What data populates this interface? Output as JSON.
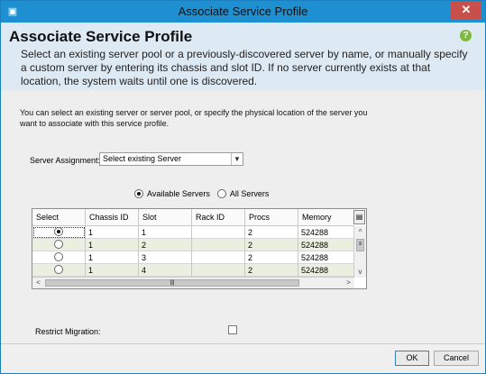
{
  "window": {
    "title": "Associate Service Profile",
    "close": "✕"
  },
  "header": {
    "heading": "Associate Service Profile",
    "help": "?",
    "description": "Select an existing server pool or a previously-discovered server by name, or manually specify a custom server by entering its chassis and slot ID. If no server currently exists at that location, the system waits until one is discovered."
  },
  "content": {
    "intro": "You can select an existing server or server pool, or specify the physical location of the server you want to associate with this service profile.",
    "server_assignment": {
      "label": "Server Assignment:",
      "value": "Select existing Server"
    },
    "filter": {
      "available": "Available Servers",
      "all": "All Servers",
      "selected": "available"
    },
    "table": {
      "columns": [
        "Select",
        "Chassis ID",
        "Slot",
        "Rack ID",
        "Procs",
        "Memory"
      ],
      "rows": [
        {
          "selected": true,
          "chassis": "1",
          "slot": "1",
          "rack": "",
          "procs": "2",
          "memory": "524288"
        },
        {
          "selected": false,
          "chassis": "1",
          "slot": "2",
          "rack": "",
          "procs": "2",
          "memory": "524288"
        },
        {
          "selected": false,
          "chassis": "1",
          "slot": "3",
          "rack": "",
          "procs": "2",
          "memory": "524288"
        },
        {
          "selected": false,
          "chassis": "1",
          "slot": "4",
          "rack": "",
          "procs": "2",
          "memory": "524288"
        }
      ]
    },
    "restrict_migration": {
      "label": "Restrict Migration:",
      "checked": false
    }
  },
  "footer": {
    "ok": "OK",
    "cancel": "Cancel"
  }
}
